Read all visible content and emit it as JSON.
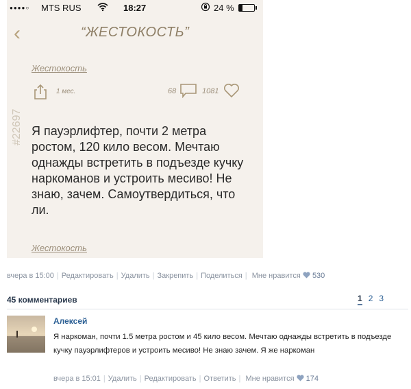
{
  "status_bar": {
    "signal": "●●●●○",
    "carrier": "MTS RUS",
    "time": "18:27",
    "battery": "24 %",
    "battery_level": 0.24
  },
  "post_card": {
    "title": "“ЖЕСТОКОСТЬ”",
    "tag_top": "Жестокость",
    "age": "1 мес.",
    "comments": "68",
    "likes": "1081",
    "post_id": "#22697",
    "story": "Я пауэрлифтер, почти 2 метра ростом, 120 кило весом. Мечтаю однажды встретить в подъезде кучку наркоманов и устроить месиво! Не знаю, зачем. Самоутвердиться, что ли.",
    "tag_bottom": "Жестокость"
  },
  "post_meta": {
    "date": "вчера в 15:00",
    "edit": "Редактировать",
    "delete": "Удалить",
    "pin": "Закрепить",
    "share": "Поделиться",
    "like_label": "Мне нравится",
    "like_count": "530"
  },
  "comments": {
    "header": "45 комментариев",
    "pages": [
      "1",
      "2",
      "3"
    ],
    "items": [
      {
        "author": "Алексей",
        "text": "Я наркоман, почти 1.5 метра ростом и 45 кило весом. Мечтаю однажды встретить в подъезде кучку пауэрлифтеров и устроить месиво! Не знаю зачем. Я же наркоман",
        "date": "вчера в 15:01",
        "delete": "Удалить",
        "edit": "Редактировать",
        "reply": "Ответить",
        "like_label": "Мне нравится",
        "like_count": "174"
      }
    ]
  },
  "colors": {
    "card_bg": "#f5f1ec",
    "accent_gold": "#b8a37e",
    "vk_link": "#2b5f94"
  }
}
